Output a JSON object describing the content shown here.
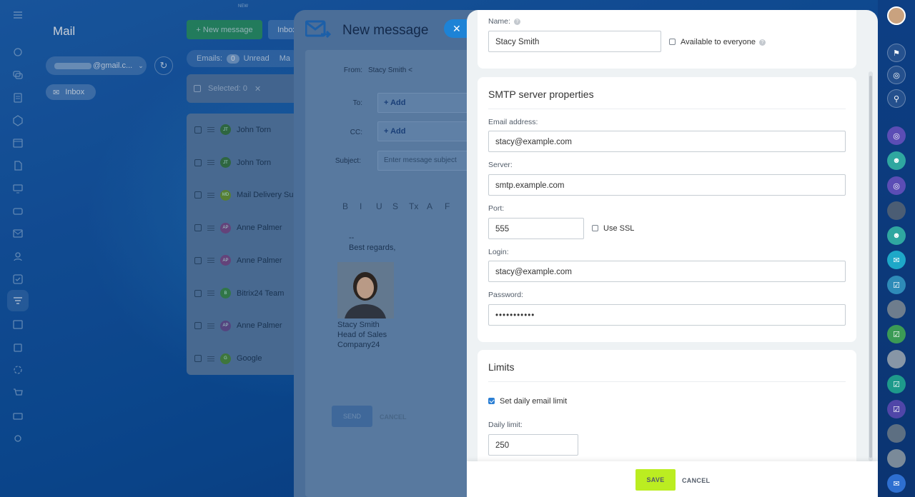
{
  "app": {
    "title": "Mail",
    "new_label": "NEW"
  },
  "mail": {
    "account": "@gmail.c...",
    "inbox_pill": "Inbox",
    "new_message_btn": "+ New message",
    "inbox_btn": "Inbox",
    "counters": {
      "emails_label": "Emails:",
      "unread_count": "0",
      "unread_label": "Unread",
      "more": "Ma"
    },
    "selected": "Selected: 0",
    "rows": [
      {
        "sender": "John Torn",
        "initials": "JT",
        "color": "#3a7a3f"
      },
      {
        "sender": "John Torn",
        "initials": "JT",
        "color": "#3a7a3f"
      },
      {
        "sender": "Mail Delivery Su",
        "initials": "MD",
        "color": "#6f9a2f"
      },
      {
        "sender": "Anne Palmer",
        "initials": "AP",
        "color": "#7f4d8a"
      },
      {
        "sender": "Anne Palmer",
        "initials": "AP",
        "color": "#7f4d8a"
      },
      {
        "sender": "Bitrix24 Team",
        "initials": "B",
        "color": "#3e8f4a"
      },
      {
        "sender": "Anne Palmer",
        "initials": "AP",
        "color": "#6b4f90"
      },
      {
        "sender": "Google",
        "initials": "G",
        "color": "#4f8f3a"
      }
    ]
  },
  "compose": {
    "title": "New message",
    "from_label": "From:",
    "from_value": "Stacy Smith <",
    "to_label": "To:",
    "cc_label": "CC:",
    "add_label": "+ Add",
    "subject_label": "Subject:",
    "subject_placeholder": "Enter message subject",
    "format_buttons": [
      "B",
      "I",
      "U",
      "S",
      "Tx",
      "A",
      "F"
    ],
    "signature": {
      "dashes": "--",
      "regards": "Best regards,",
      "name": "Stacy Smith",
      "position": "Head of Sales",
      "company": "Company24"
    },
    "send_label": "SEND",
    "cancel_label": "CANCEL"
  },
  "settings": {
    "name_label": "Name:",
    "name_value": "Stacy Smith",
    "available_label": "Available to everyone",
    "available_checked": false,
    "smtp": {
      "title": "SMTP server properties",
      "email_label": "Email address:",
      "email_value": "stacy@example.com",
      "server_label": "Server:",
      "server_value": "smtp.example.com",
      "port_label": "Port:",
      "port_value": "555",
      "ssl_label": "Use SSL",
      "ssl_checked": false,
      "login_label": "Login:",
      "login_value": "stacy@example.com",
      "password_label": "Password:",
      "password_value": "•••••••••••"
    },
    "limits": {
      "title": "Limits",
      "daily_limit_checkbox": "Set daily email limit",
      "daily_limit_checked": true,
      "daily_limit_label": "Daily limit:",
      "daily_limit_value": "250"
    },
    "save_label": "SAVE",
    "cancel_label": "CANCEL"
  },
  "colors": {
    "save_button": "#bbed21",
    "accent_blue": "#1d83d6",
    "new_message_green": "#2f9f57"
  }
}
